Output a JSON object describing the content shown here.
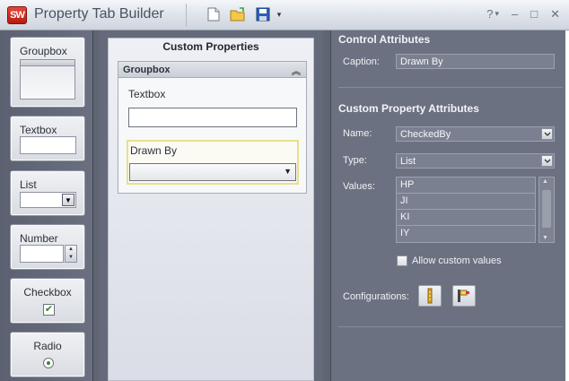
{
  "app": {
    "logo_text": "SW",
    "title": "Property Tab Builder"
  },
  "toolbar": {
    "new_icon": "new-file-icon",
    "open_icon": "open-folder-icon",
    "save_icon": "save-icon"
  },
  "window": {
    "help": "?",
    "min": "–",
    "max": "□",
    "close": "✕"
  },
  "palette": {
    "groupbox": "Groupbox",
    "textbox": "Textbox",
    "list": "List",
    "number": "Number",
    "checkbox": "Checkbox",
    "radio": "Radio"
  },
  "custom": {
    "title": "Custom Properties",
    "group_title": "Groupbox",
    "textbox_label": "Textbox",
    "textbox_value": "",
    "list_label": "Drawn By",
    "list_value": ""
  },
  "control_attributes": {
    "title": "Control Attributes",
    "caption_label": "Caption:",
    "caption_value": "Drawn By"
  },
  "custom_property_attributes": {
    "title": "Custom Property Attributes",
    "name_label": "Name:",
    "name_value": "CheckedBy",
    "type_label": "Type:",
    "type_value": "List",
    "values_label": "Values:",
    "values": [
      "HP",
      "JI",
      "KI",
      "IY"
    ],
    "allow_custom_label": "Allow custom values",
    "configurations_label": "Configurations:"
  },
  "colors": {
    "accent_red": "#c9281d",
    "highlight_yellow": "#e8e08a"
  }
}
